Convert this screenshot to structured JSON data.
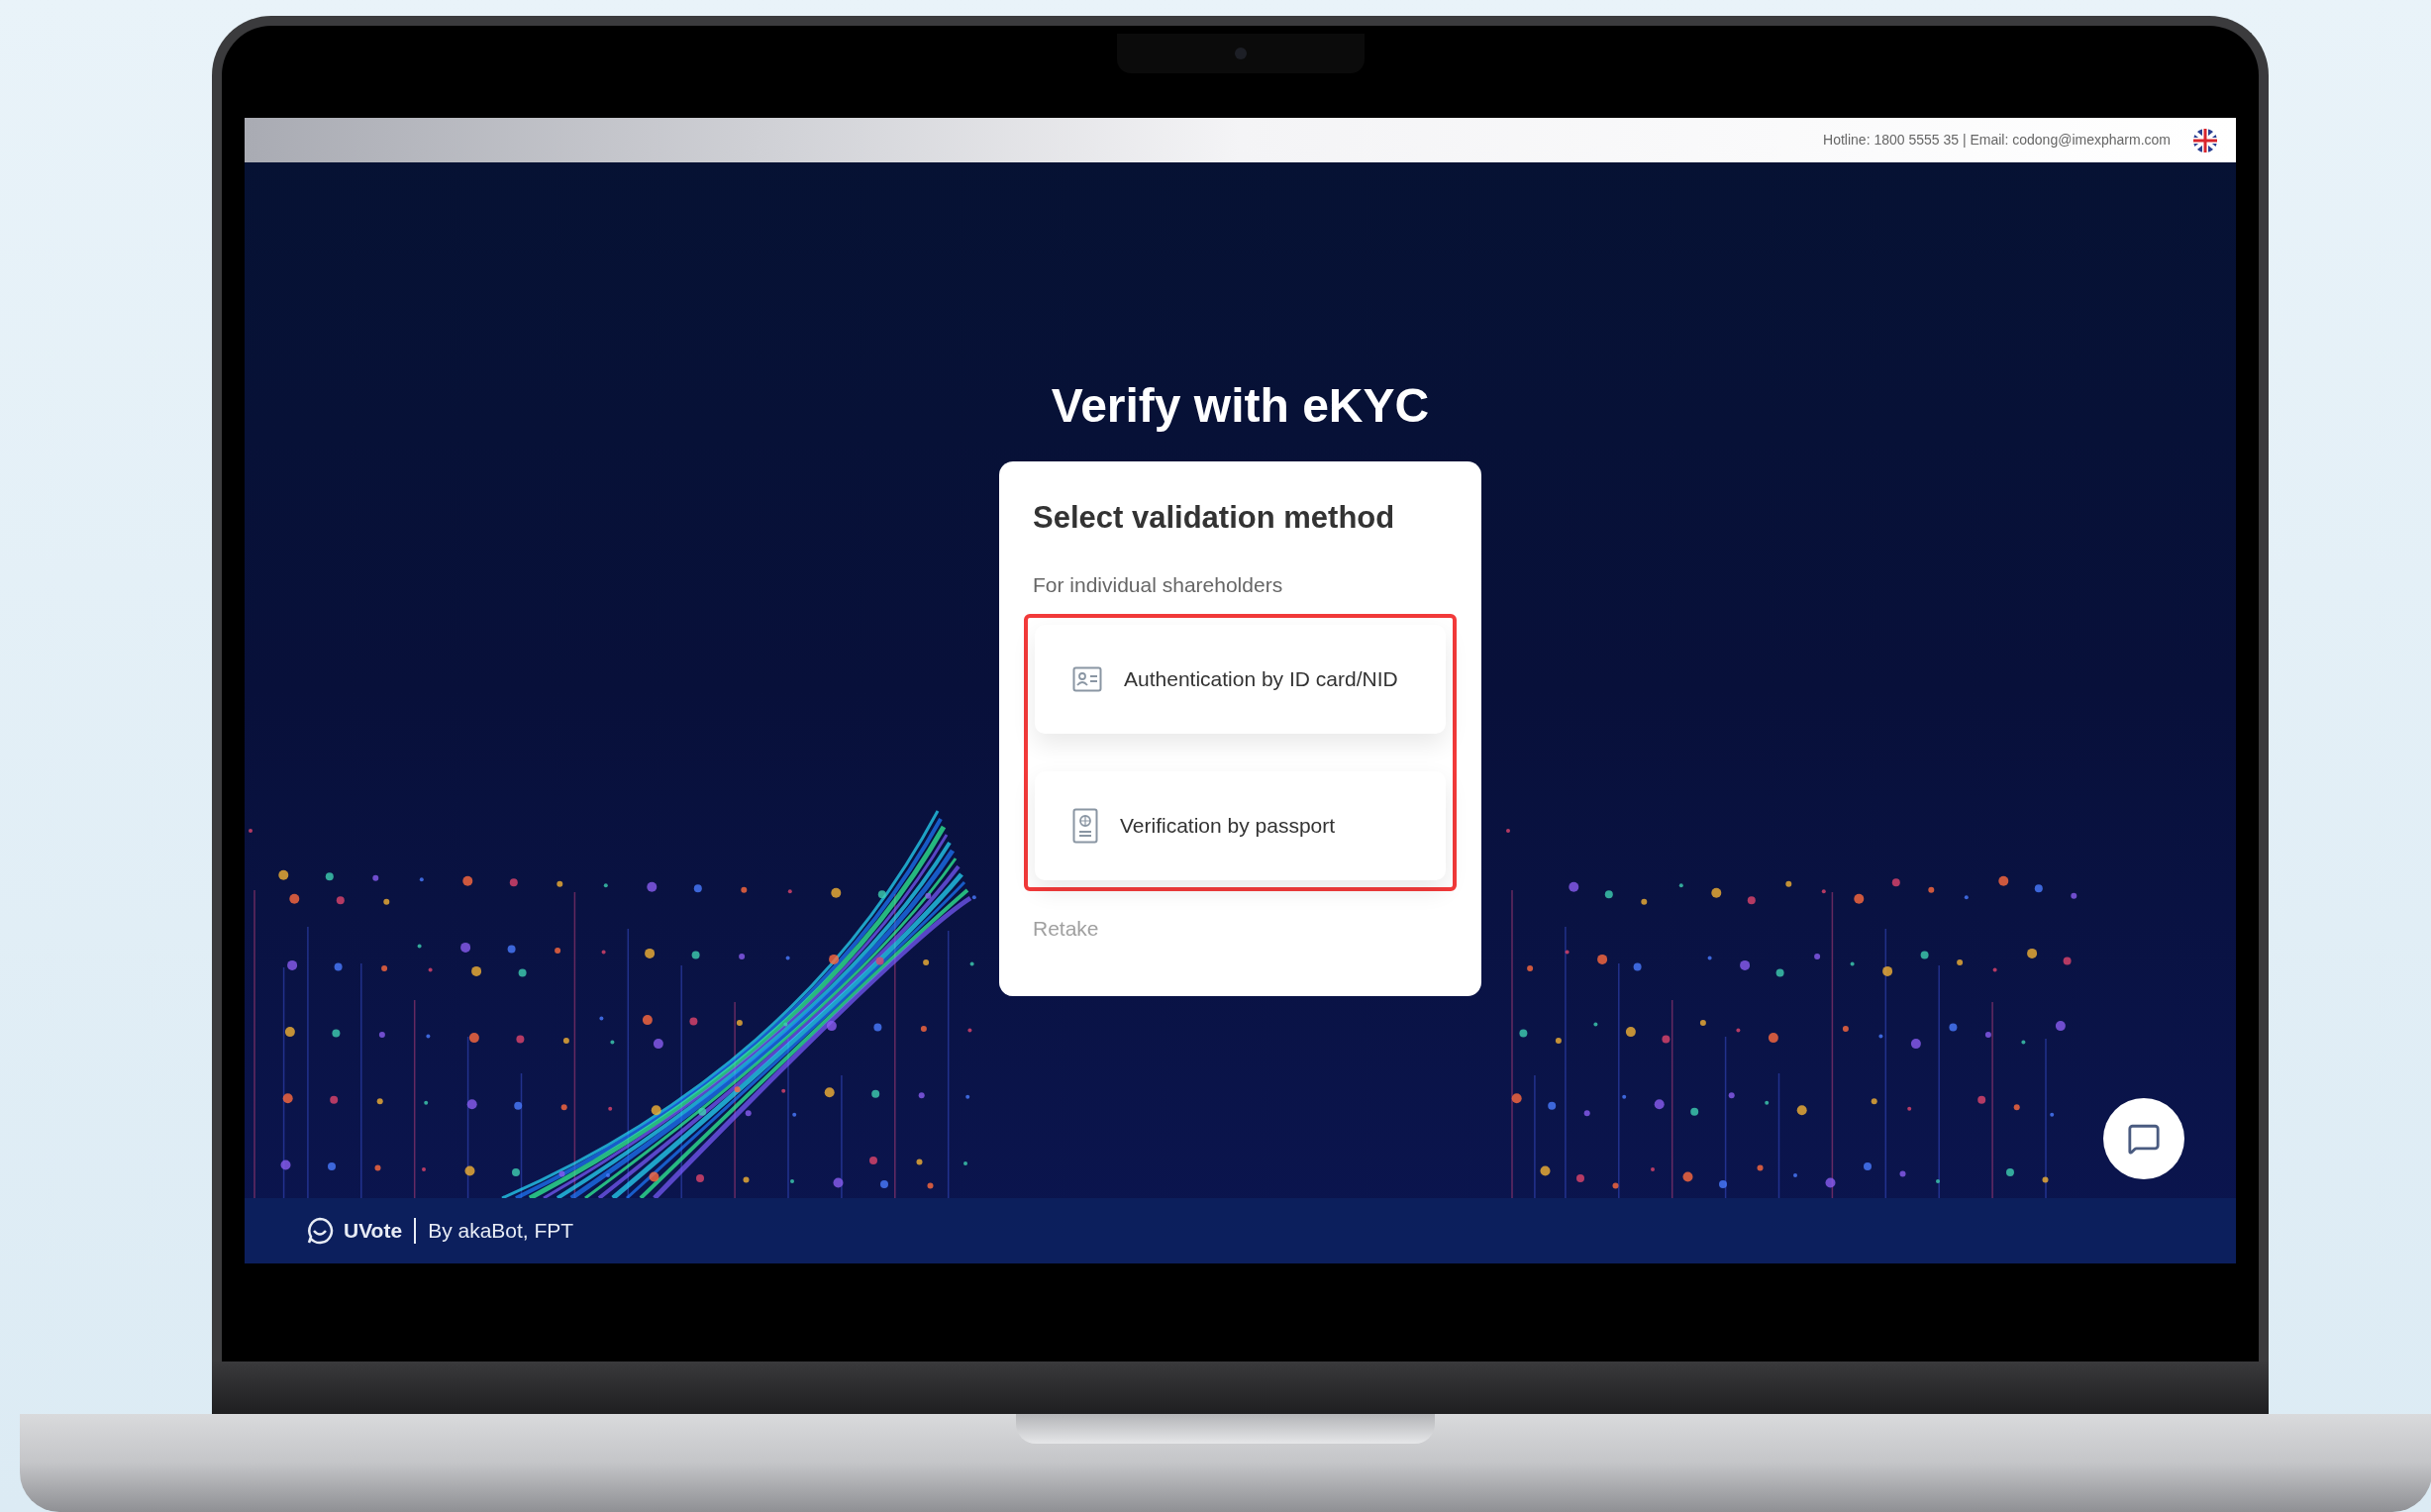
{
  "top_bar": {
    "contact": "Hotline: 1800 5555 35 | Email: codong@imexpharm.com"
  },
  "page_title": "Verify with eKYC",
  "card": {
    "title": "Select validation method",
    "subtitle": "For individual shareholders",
    "options": [
      {
        "kind": "id_card",
        "label": "Authentication by ID card/NID"
      },
      {
        "kind": "passport",
        "label": "Verification by passport"
      }
    ],
    "retake": "Retake"
  },
  "footer": {
    "brand": "UVote",
    "credit": "By akaBot, FPT"
  }
}
